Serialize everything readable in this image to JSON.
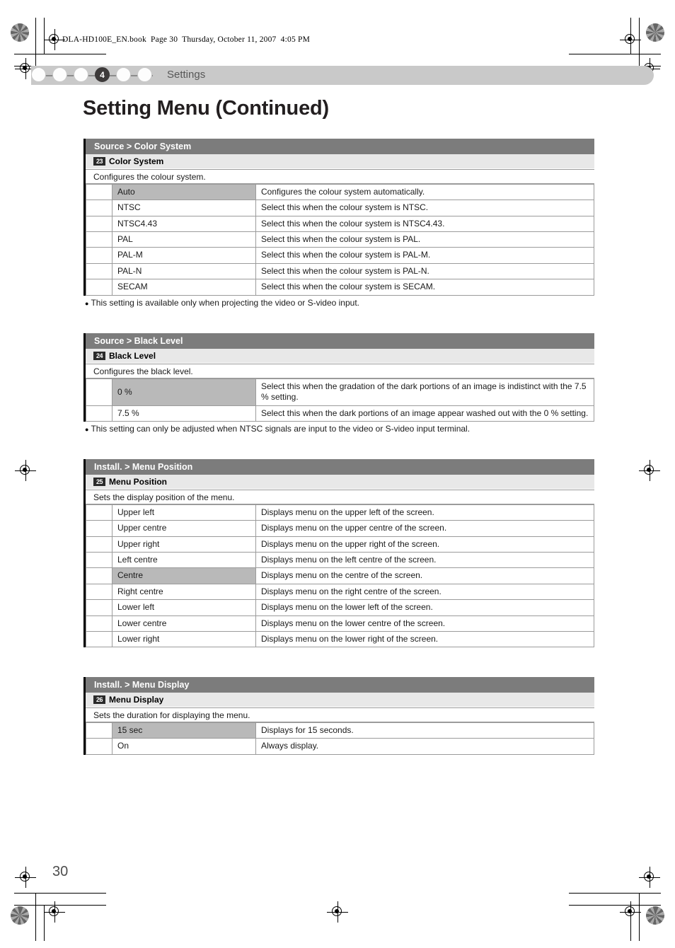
{
  "printmark": {
    "book_line": "DLA-HD100E_EN.book  Page 30  Thursday, October 11, 2007  4:05 PM"
  },
  "header": {
    "chapter_number": "4",
    "label": "Settings",
    "dot_count": 6,
    "active_dot_index": 3
  },
  "page_title": "Setting Menu (Continued)",
  "page_number": "30",
  "colors": {
    "section_header_bg": "#7c7c7c",
    "section_sub_bg": "#e8e8e8",
    "highlight_row_bg": "#b9b9b9",
    "band_bg": "#c9c9c9",
    "badge_bg": "#2a2a2a",
    "rule": "#9b9b9b"
  },
  "sections": [
    {
      "title": "Source > Color System",
      "badge": "23",
      "sub_label": "Color System",
      "description": "Configures the colour system.",
      "columns": [
        "option",
        "description"
      ],
      "rows": [
        {
          "option": "Auto",
          "description": "Configures the colour system automatically.",
          "highlight": true
        },
        {
          "option": "NTSC",
          "description": "Select this when the colour system is NTSC.",
          "highlight": false
        },
        {
          "option": "NTSC4.43",
          "description": "Select this when the colour system is NTSC4.43.",
          "highlight": false
        },
        {
          "option": "PAL",
          "description": "Select this when the colour system is PAL.",
          "highlight": false
        },
        {
          "option": "PAL-M",
          "description": "Select this when the colour system is PAL-M.",
          "highlight": false
        },
        {
          "option": "PAL-N",
          "description": "Select this when the colour system is PAL-N.",
          "highlight": false
        },
        {
          "option": "SECAM",
          "description": "Select this when the colour system is SECAM.",
          "highlight": false
        }
      ],
      "note": "This setting is available only when projecting the video or S-video input."
    },
    {
      "title": "Source > Black Level",
      "badge": "24",
      "sub_label": "Black Level",
      "description": "Configures the black level.",
      "columns": [
        "option",
        "description"
      ],
      "rows": [
        {
          "option": "0 %",
          "description": "Select this when the gradation of the dark portions of an image is indistinct with the 7.5 % setting.",
          "highlight": true
        },
        {
          "option": "7.5 %",
          "description": "Select this when the dark portions of an image appear washed out with the 0 % setting.",
          "highlight": false
        }
      ],
      "note": "This setting can only be adjusted when NTSC signals are input to the video or S-video input terminal."
    },
    {
      "title": "Install. > Menu Position",
      "badge": "25",
      "sub_label": "Menu Position",
      "description": "Sets the display position of the menu.",
      "columns": [
        "option",
        "description"
      ],
      "rows": [
        {
          "option": "Upper left",
          "description": "Displays menu on the upper left of the screen.",
          "highlight": false
        },
        {
          "option": "Upper centre",
          "description": "Displays menu on the upper centre of the screen.",
          "highlight": false
        },
        {
          "option": "Upper right",
          "description": "Displays menu on the upper right of the screen.",
          "highlight": false
        },
        {
          "option": "Left centre",
          "description": "Displays menu on the left centre of the screen.",
          "highlight": false
        },
        {
          "option": "Centre",
          "description": "Displays menu on the centre of the screen.",
          "highlight": true
        },
        {
          "option": "Right centre",
          "description": "Displays menu on the right centre of the screen.",
          "highlight": false
        },
        {
          "option": "Lower left",
          "description": "Displays menu on the lower left of the screen.",
          "highlight": false
        },
        {
          "option": "Lower centre",
          "description": "Displays menu on the lower centre of the screen.",
          "highlight": false
        },
        {
          "option": "Lower right",
          "description": "Displays menu on the lower right of the screen.",
          "highlight": false
        }
      ],
      "note": ""
    },
    {
      "title": "Install. > Menu Display",
      "badge": "26",
      "sub_label": "Menu Display",
      "description": "Sets the duration for displaying the menu.",
      "columns": [
        "option",
        "description"
      ],
      "rows": [
        {
          "option": "15 sec",
          "description": "Displays for 15 seconds.",
          "highlight": true
        },
        {
          "option": "On",
          "description": "Always display.",
          "highlight": false
        }
      ],
      "note": ""
    }
  ]
}
